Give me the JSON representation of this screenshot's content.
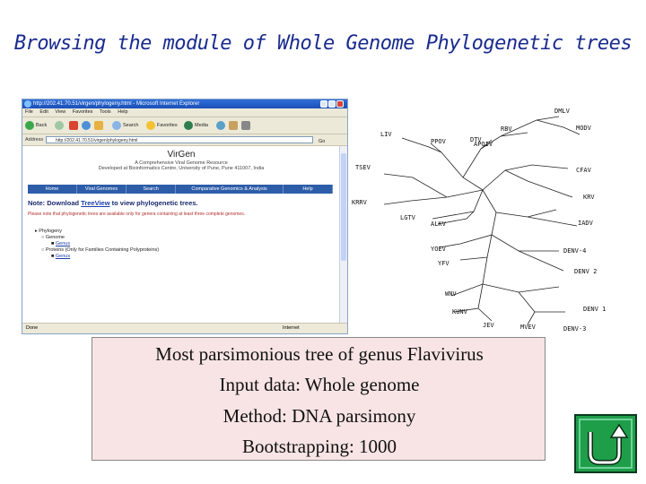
{
  "slide": {
    "title": "Browsing the module of Whole Genome Phylogenetic trees",
    "caption": {
      "line1": "Most parsimonious tree of genus Flavivirus",
      "line2": "Input data: Whole genome",
      "line3": "Method: DNA parsimony",
      "line4": "Bootstrapping: 1000"
    },
    "return_button": {
      "icon": "u-turn-arrow-icon",
      "color": "#1f9e4a"
    }
  },
  "browser": {
    "window_title": "http://202.41.70.51/virgen/phylogeny.html - Microsoft Internet Explorer",
    "menu": [
      "File",
      "Edit",
      "View",
      "Favorites",
      "Tools",
      "Help"
    ],
    "toolbar": {
      "back": "Back",
      "search": "Search",
      "favorites": "Favorites",
      "media": "Media"
    },
    "address": {
      "label": "Address",
      "value": "http://202.41.70.51/virgen/phylogeny.html",
      "go": "Go"
    },
    "status": {
      "left": "Done",
      "right": "Internet"
    },
    "page": {
      "logo": "VirGen",
      "subtitle1": "A Comprehensive Viral Genome Resource",
      "subtitle2": "Developed at Bioinformatics Centre, University of Pune, Pune 411007, India",
      "nav": [
        "Home",
        "Viral Genomes",
        "Search",
        "Comparative Genomics & Analysis",
        "Help"
      ],
      "note_prefix": "Note: Download ",
      "note_link": "TreeView",
      "note_suffix": " to view phylogenetic trees.",
      "note_sub": "Please note that phylogenetic trees are available only for genera containing at least three complete genomes.",
      "tree": {
        "root": "Phylogeny",
        "genome": "Genome",
        "genome_child": "Genus",
        "protein": "Proteins (Only for Families Containing Polyproteins)",
        "protein_child": "Genus"
      }
    }
  },
  "phylo_tree": {
    "labels": [
      "DMLV",
      "MODV",
      "LIV",
      "RBV",
      "PPOV",
      "DTV",
      "APOIV",
      "TSEV",
      "CFAV",
      "KRV",
      "KRRV",
      "LGTV",
      "ALKV",
      "IADV",
      "YOEV",
      "DENV-4",
      "YFV",
      "DENV 2",
      "WNV",
      "KUNV",
      "DENV 1",
      "JEV",
      "MVEV",
      "DENV-3"
    ]
  }
}
